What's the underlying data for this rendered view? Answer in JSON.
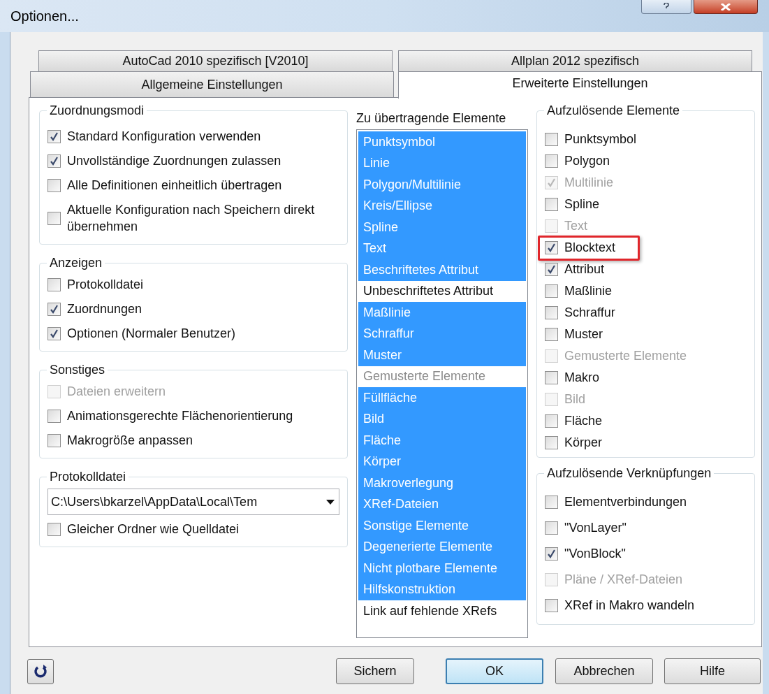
{
  "window": {
    "title": "Optionen..."
  },
  "tab_rows": [
    {
      "tabs": [
        {
          "label": "AutoCad 2010 spezifisch [V2010]",
          "selected": false
        },
        {
          "label": "Allplan 2012 spezifisch",
          "selected": false
        }
      ]
    },
    {
      "tabs": [
        {
          "label": "Allgemeine Einstellungen",
          "selected": false
        },
        {
          "label": "Erweiterte Einstellungen",
          "selected": true
        }
      ]
    }
  ],
  "left_groups": [
    {
      "title": "Zuordnungsmodi",
      "items": [
        {
          "kind": "checkbox",
          "label": "Standard Konfiguration verwenden",
          "checked": true,
          "disabled": false
        },
        {
          "kind": "checkbox",
          "label": "Unvollständige Zuordnungen zulassen",
          "checked": true,
          "disabled": false
        },
        {
          "kind": "checkbox",
          "label": "Alle Definitionen einheitlich übertragen",
          "checked": false,
          "disabled": false
        },
        {
          "kind": "checkbox",
          "label": "Aktuelle Konfiguration nach Speichern direkt übernehmen",
          "checked": false,
          "disabled": false
        }
      ]
    },
    {
      "title": "Anzeigen",
      "items": [
        {
          "kind": "checkbox",
          "label": "Protokolldatei",
          "checked": false,
          "disabled": false
        },
        {
          "kind": "checkbox",
          "label": "Zuordnungen",
          "checked": true,
          "disabled": false
        },
        {
          "kind": "checkbox",
          "label": "Optionen (Normaler Benutzer)",
          "checked": true,
          "disabled": false
        }
      ]
    },
    {
      "title": "Sonstiges",
      "items": [
        {
          "kind": "checkbox",
          "label": "Dateien erweitern",
          "checked": false,
          "disabled": true
        },
        {
          "kind": "checkbox",
          "label": "Animationsgerechte Flächenorientierung",
          "checked": false,
          "disabled": false
        },
        {
          "kind": "checkbox",
          "label": "Makrogröße anpassen",
          "checked": false,
          "disabled": false
        }
      ]
    },
    {
      "title": "Protokolldatei",
      "items": [
        {
          "kind": "dropdown",
          "value": "C:\\Users\\bkarzel\\AppData\\Local\\Tem"
        },
        {
          "kind": "checkbox",
          "label": "Gleicher Ordner wie Quelldatei",
          "checked": false,
          "disabled": false
        }
      ]
    }
  ],
  "element_list": {
    "title": "Zu übertragende Elemente",
    "items": [
      {
        "label": "Punktsymbol",
        "selected": true,
        "disabled": false
      },
      {
        "label": "Linie",
        "selected": true,
        "disabled": false
      },
      {
        "label": "Polygon/Multilinie",
        "selected": true,
        "disabled": false
      },
      {
        "label": "Kreis/Ellipse",
        "selected": true,
        "disabled": false
      },
      {
        "label": "Spline",
        "selected": true,
        "disabled": false
      },
      {
        "label": "Text",
        "selected": true,
        "disabled": false
      },
      {
        "label": "Beschriftetes Attribut",
        "selected": true,
        "disabled": false
      },
      {
        "label": "Unbeschriftetes Attribut",
        "selected": false,
        "disabled": false
      },
      {
        "label": "Maßlinie",
        "selected": true,
        "disabled": false
      },
      {
        "label": "Schraffur",
        "selected": true,
        "disabled": false
      },
      {
        "label": "Muster",
        "selected": true,
        "disabled": false
      },
      {
        "label": "Gemusterte Elemente",
        "selected": false,
        "disabled": true
      },
      {
        "label": "Füllfläche",
        "selected": true,
        "disabled": false
      },
      {
        "label": "Bild",
        "selected": true,
        "disabled": false
      },
      {
        "label": "Fläche",
        "selected": true,
        "disabled": false
      },
      {
        "label": "Körper",
        "selected": true,
        "disabled": false
      },
      {
        "label": "Makroverlegung",
        "selected": true,
        "disabled": false
      },
      {
        "label": "XRef-Dateien",
        "selected": true,
        "disabled": false
      },
      {
        "label": "Sonstige Elemente",
        "selected": true,
        "disabled": false
      },
      {
        "label": "Degenerierte Elemente",
        "selected": true,
        "disabled": false
      },
      {
        "label": "Nicht plotbare Elemente",
        "selected": true,
        "disabled": false
      },
      {
        "label": "Hilfskonstruktion",
        "selected": true,
        "disabled": false
      },
      {
        "label": "Link auf fehlende XRefs",
        "selected": false,
        "disabled": false
      }
    ]
  },
  "right_groups": [
    {
      "title": "Aufzulösende Elemente",
      "items": [
        {
          "label": "Punktsymbol",
          "checked": false,
          "disabled": false,
          "highlighted": false
        },
        {
          "label": "Polygon",
          "checked": false,
          "disabled": false,
          "highlighted": false
        },
        {
          "label": "Multilinie",
          "checked": true,
          "disabled": true,
          "highlighted": false
        },
        {
          "label": "Spline",
          "checked": false,
          "disabled": false,
          "highlighted": false
        },
        {
          "label": "Text",
          "checked": false,
          "disabled": true,
          "highlighted": false
        },
        {
          "label": "Blocktext",
          "checked": true,
          "disabled": false,
          "highlighted": true
        },
        {
          "label": "Attribut",
          "checked": true,
          "disabled": false,
          "highlighted": false
        },
        {
          "label": "Maßlinie",
          "checked": false,
          "disabled": false,
          "highlighted": false
        },
        {
          "label": "Schraffur",
          "checked": false,
          "disabled": false,
          "highlighted": false
        },
        {
          "label": "Muster",
          "checked": false,
          "disabled": false,
          "highlighted": false
        },
        {
          "label": "Gemusterte Elemente",
          "checked": false,
          "disabled": true,
          "highlighted": false
        },
        {
          "label": "Makro",
          "checked": false,
          "disabled": false,
          "highlighted": false
        },
        {
          "label": "Bild",
          "checked": false,
          "disabled": true,
          "highlighted": false
        },
        {
          "label": "Fläche",
          "checked": false,
          "disabled": false,
          "highlighted": false
        },
        {
          "label": "Körper",
          "checked": false,
          "disabled": false,
          "highlighted": false
        }
      ]
    },
    {
      "title": "Aufzulösende Verknüpfungen",
      "items": [
        {
          "label": "Elementverbindungen",
          "checked": false,
          "disabled": false,
          "highlighted": false
        },
        {
          "label": "\"VonLayer\"",
          "checked": false,
          "disabled": false,
          "highlighted": false
        },
        {
          "label": "\"VonBlock\"",
          "checked": true,
          "disabled": false,
          "highlighted": false
        },
        {
          "label": "Pläne / XRef-Dateien",
          "checked": false,
          "disabled": true,
          "highlighted": false
        },
        {
          "label": "XRef in Makro wandeln",
          "checked": false,
          "disabled": false,
          "highlighted": false
        }
      ]
    }
  ],
  "buttons": [
    {
      "label": "Sichern",
      "default": false
    },
    {
      "label": "OK",
      "default": true
    },
    {
      "label": "Abbrechen",
      "default": false
    },
    {
      "label": "Hilfe",
      "default": false
    }
  ]
}
